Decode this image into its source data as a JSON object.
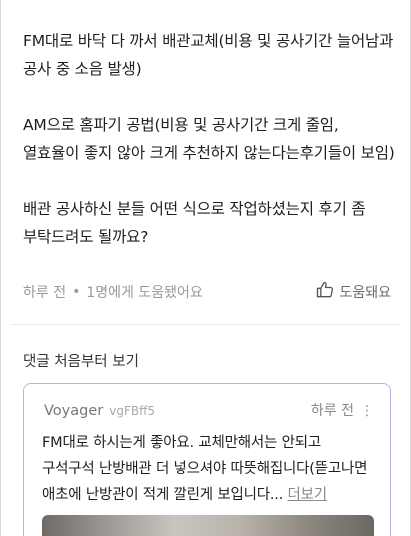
{
  "post": {
    "paragraphs": [
      "FM대로 바닥 다 까서 배관교체(비용 및 공사기간 늘어남과 공사 중 소음 발생)",
      "AM으로 홈파기 공법(비용 및 공사기간 크게 줄임, 열효율이 좋지 않아 크게 추천하지 않는다는후기들이 보임)",
      "배관 공사하신 분들 어떤 식으로 작업하셨는지 후기 좀 부탁드려도 될까요?"
    ],
    "time": "하루 전",
    "helpful_count": "1명에게 도움됐어요",
    "like_label": "도움돼요"
  },
  "comments": {
    "header": "댓글 처음부터 보기",
    "items": [
      {
        "author": "Voyager",
        "handle": "vgFBff5",
        "time": "하루 전",
        "text": "FM대로 하시는게 좋아요. 교체만해서는 안되고  구석구석 난방배관 더 넣으셔야 따뜻해집니다(뜯고나면 애초에 난방관이 적게 깔린게 보입니다...",
        "more_label": "더보기"
      }
    ]
  },
  "colors": {
    "card_border": "#b9aee8",
    "muted_text": "#9a9a9a"
  }
}
